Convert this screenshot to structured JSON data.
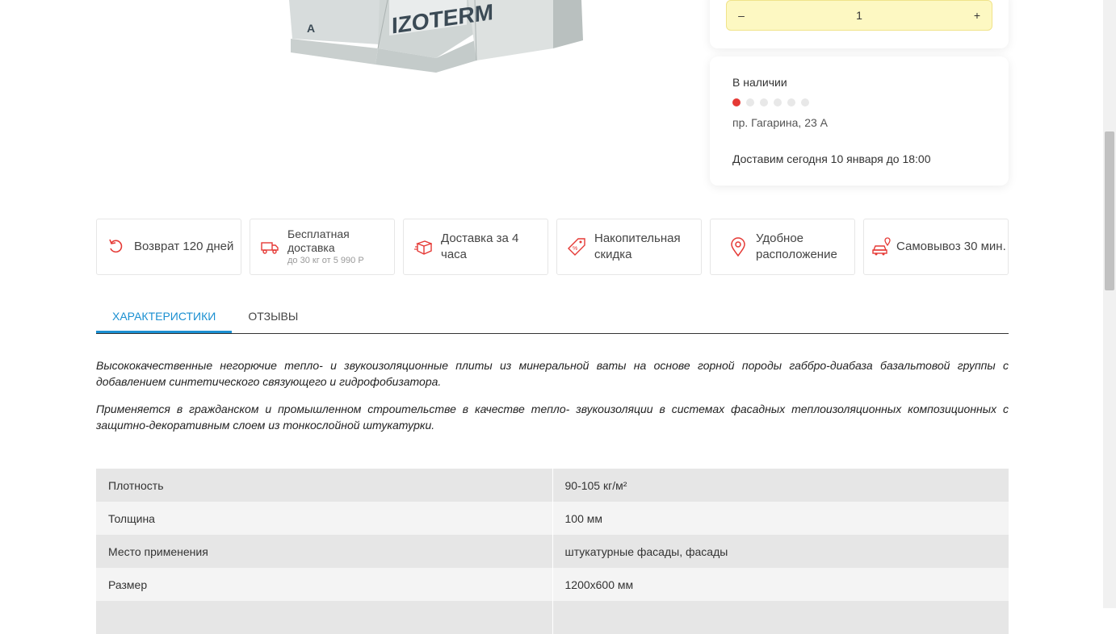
{
  "product_image": {
    "brand": "IZOTERM"
  },
  "quantity": {
    "minus": "–",
    "value": "1",
    "plus": "+"
  },
  "stock": {
    "status": "В наличии",
    "address": "пр. Гагарина, 23 А",
    "delivery": "Доставим сегодня 10 января до 18:00",
    "level_dots_total": 6,
    "level_dots_active": 1
  },
  "features": [
    {
      "icon": "return-icon",
      "label": "Возврат 120 дней"
    },
    {
      "icon": "free-delivery-truck-icon",
      "label": "Бесплатная доставка",
      "sub": "до 30 кг от 5 990 Р"
    },
    {
      "icon": "box-icon",
      "label": "Доставка за 4 часа"
    },
    {
      "icon": "discount-tag-icon",
      "label": "Накопительная скидка"
    },
    {
      "icon": "location-pin-icon",
      "label": "Удобное расположение"
    },
    {
      "icon": "car-pickup-icon",
      "label": "Самовывоз 30 мин."
    }
  ],
  "tabs": [
    {
      "label": "ХАРАКТЕРИСТИКИ",
      "active": true
    },
    {
      "label": "ОТЗЫВЫ",
      "active": false
    }
  ],
  "description": [
    "Высококачественные негорючие тепло- и звукоизоляционные плиты из минеральной ваты на основе горной породы габбро-диабаза базальтовой группы с добавлением синтетического связующего и гидрофобизатора.",
    "Применяется в гражданском и промышленном строительстве в качестве тепло- звукоизоляции в системах фасадных теплоизоляционных композиционных с защитно-декоративным слоем из тонкослойной штукатурки."
  ],
  "specs": [
    {
      "key": "Плотность",
      "value": "90-105 кг/м²"
    },
    {
      "key": "Толщина",
      "value": "100 мм"
    },
    {
      "key": "Место применения",
      "value": "штукатурные фасады, фасады"
    },
    {
      "key": "Размер",
      "value": "1200х600 мм"
    },
    {
      "key": "",
      "value": ""
    }
  ],
  "colors": {
    "accent": "#1a8fd1",
    "icon_red": "#e53935",
    "qty_bg": "#fdf8c2"
  }
}
